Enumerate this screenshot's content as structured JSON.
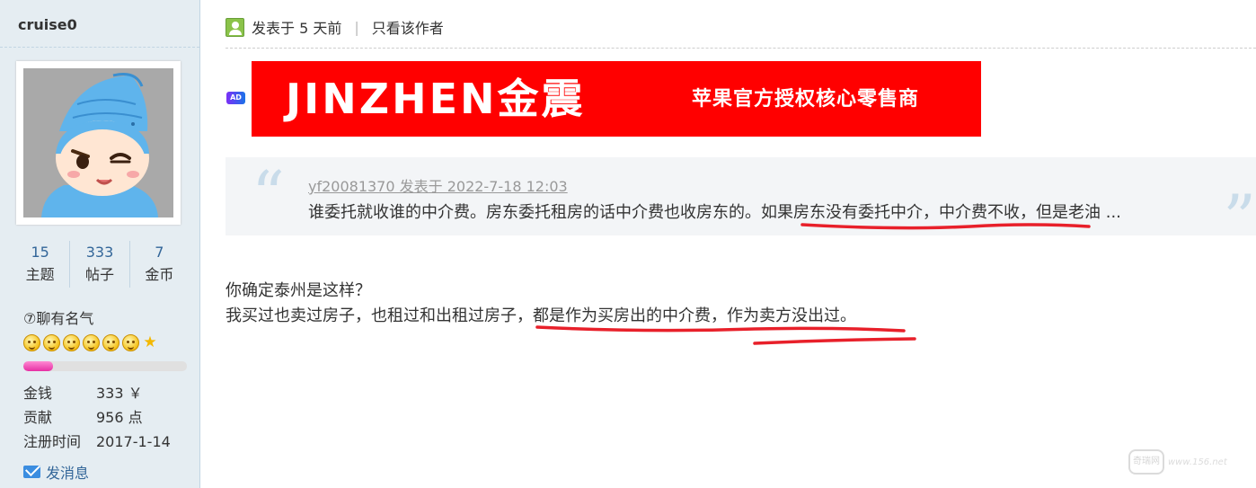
{
  "author": {
    "username": "cruise0",
    "avatar": "cartoon-avatar",
    "stats": [
      {
        "value": "15",
        "label": "主题"
      },
      {
        "value": "333",
        "label": "帖子"
      },
      {
        "value": "7",
        "label": "金币"
      }
    ],
    "rank_prefix": "⑦",
    "rank_title": "聊有名气",
    "level_faces": 6,
    "level_stars": 1,
    "level_progress": 0.18,
    "level_bar_color": "#e62fa4",
    "info": [
      {
        "key": "金钱",
        "value": "333 ￥"
      },
      {
        "key": "贡献",
        "value": "956 点"
      },
      {
        "key": "注册时间",
        "value": "2017-1-14"
      }
    ],
    "send_message": "发消息",
    "send_message_icon": "mail-icon"
  },
  "post": {
    "posted_at": "发表于 5 天前",
    "separator": "|",
    "only_author": "只看该作者",
    "online_icon": "user-online-icon"
  },
  "ad": {
    "tag": "AD",
    "brand": "JINZHEN金震",
    "tagline": "苹果官方授权核心零售商",
    "color": "#ff0000"
  },
  "quote": {
    "meta": "yf20081370 发表于 2022-7-18 12:03",
    "text": "谁委托就收谁的中介费。房东委托租房的话中介费也收房东的。如果房东没有委托中介，中介费不收，但是老油 ..."
  },
  "reply": {
    "line1": "你确定泰州是这样？",
    "line2": "我买过也卖过房子，也租过和出租过房子，都是作为买房出的中介费，作为卖方没出过。"
  },
  "annotation_color": "#e8202a",
  "watermark": {
    "logo": "奇瑞网",
    "text": "www.156.net"
  }
}
